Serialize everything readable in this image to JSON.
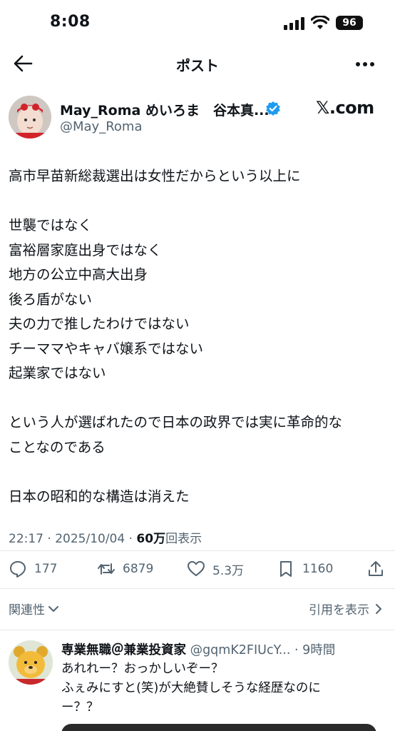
{
  "status_bar": {
    "time": "8:08",
    "battery": "96"
  },
  "nav": {
    "title": "ポスト"
  },
  "post": {
    "author_name": "May_Roma めいろま　谷本真...",
    "author_handle": "@May_Roma",
    "source": "𝕏.com",
    "lines": [
      "高市早苗新総裁選出は女性だからという以上に",
      "",
      "世襲ではなく",
      "富裕層家庭出身ではなく",
      "地方の公立中高大出身",
      "後ろ盾がない",
      "夫の力で推したわけではない",
      "チーママやキャバ嬢系ではない",
      "起業家ではない",
      "",
      "という人が選ばれたので日本の政界では実に革命的な",
      "ことなのである",
      "",
      "日本の昭和的な構造は消えた"
    ],
    "timestamp": "22:17 · 2025/10/04 · ",
    "views_count": "60万",
    "views_label": "回表示",
    "replies": "177",
    "reposts": "6879",
    "likes": "5.3万",
    "bookmarks": "1160"
  },
  "filters": {
    "relevance": "関連性",
    "quotes": "引用を表示"
  },
  "reply": {
    "name": "専業無職＠兼業投資家",
    "handle": " @gqmK2FIUcY...",
    "time": " · 9時間",
    "lines": [
      "あれれー？おっかしいぞー？",
      "ふぇみにすと(笑)が大絶賛しそうな経歴なのに",
      "ー？？"
    ]
  },
  "colors": {
    "text": "#0f1419",
    "secondary": "#536471",
    "verified": "#1d9bf0",
    "divider": "#e6e9eb"
  }
}
